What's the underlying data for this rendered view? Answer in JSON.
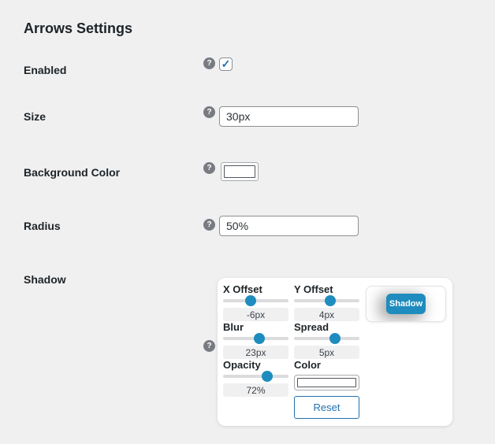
{
  "panel": {
    "title": "Arrows Settings"
  },
  "icons": {
    "help": "?",
    "check": "✓"
  },
  "colors": {
    "page_bg": "#f0f0f1",
    "accent_blue": "#1e8cbe",
    "wp_blue": "#2271b1",
    "label_text": "#1d2327"
  },
  "fields": {
    "enabled": {
      "label": "Enabled",
      "checked": true
    },
    "size": {
      "label": "Size",
      "value": "30px"
    },
    "background_color": {
      "label": "Background Color",
      "swatch_color": "#ffffff"
    },
    "radius": {
      "label": "Radius",
      "value": "50%"
    },
    "shadow": {
      "label": "Shadow",
      "sliders": {
        "x_offset": {
          "label": "X Offset",
          "value": "-6px",
          "thumb_left": "42%"
        },
        "y_offset": {
          "label": "Y Offset",
          "value": "4px",
          "thumb_left": "55%"
        },
        "blur": {
          "label": "Blur",
          "value": "23px",
          "thumb_left": "55%"
        },
        "spread": {
          "label": "Spread",
          "value": "5px",
          "thumb_left": "63%"
        },
        "opacity": {
          "label": "Opacity",
          "value": "72%",
          "thumb_left": "68%"
        }
      },
      "color": {
        "label": "Color",
        "swatch_color": "#ffffff"
      },
      "preview": {
        "button_label": "Shadow"
      },
      "reset_label": "Reset"
    }
  }
}
